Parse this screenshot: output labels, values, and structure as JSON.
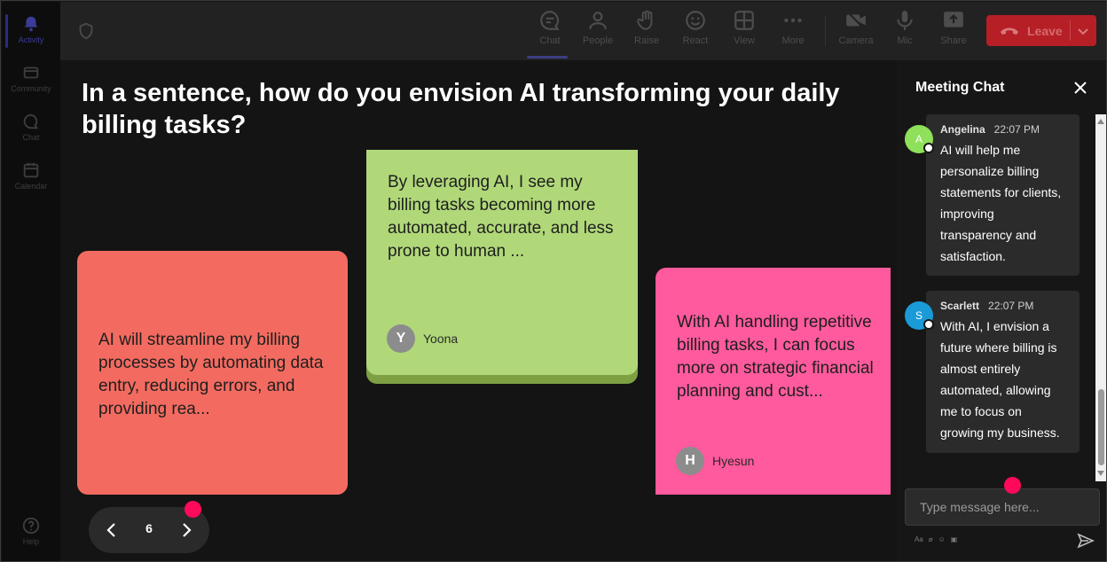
{
  "rail": {
    "items": [
      {
        "label": "Activity",
        "icon": "bell-icon"
      },
      {
        "label": "Community",
        "icon": "community-icon"
      },
      {
        "label": "Chat",
        "icon": "chat-icon"
      },
      {
        "label": "Calendar",
        "icon": "calendar-icon"
      }
    ],
    "help": "Help"
  },
  "toolbar": {
    "chat": "Chat",
    "people": "People",
    "raise": "Raise",
    "react": "React",
    "view": "View",
    "more": "More",
    "camera": "Camera",
    "mic": "Mic",
    "share": "Share",
    "leave": "Leave"
  },
  "board": {
    "question": "In a sentence, how do you envision AI transforming your daily billing tasks?",
    "cards": [
      {
        "text": "AI will streamline my billing processes by automating data entry, reducing errors, and providing rea...",
        "color": "#f36b60"
      },
      {
        "text": "By leveraging AI, I see my billing tasks becoming more automated, accurate, and less prone to human ...",
        "author": "Yoona",
        "initial": "Y",
        "color": "#b0d879"
      },
      {
        "text": "With AI handling repetitive billing tasks, I can focus more on strategic financial planning and cust...",
        "author": "Hyesun",
        "initial": "H",
        "color": "#ff5a9d"
      }
    ],
    "page": "6"
  },
  "chat": {
    "title": "Meeting Chat",
    "messages": [
      {
        "name": "Angelina",
        "time": "22:07 PM",
        "initial": "A",
        "avatar_color": "#8fe05a",
        "text": "AI will help me personalize billing statements for clients, improving transparency and satisfaction."
      },
      {
        "name": "Scarlett",
        "time": "22:07 PM",
        "initial": "S",
        "avatar_color": "#1a9bd7",
        "text": "With AI, I envision a future where billing is almost entirely automated, allowing me to focus on growing my business."
      }
    ],
    "placeholder": "Type message here..."
  },
  "colors": {
    "leave": "#b51f25",
    "notification_dot": "#ff0a5a"
  }
}
